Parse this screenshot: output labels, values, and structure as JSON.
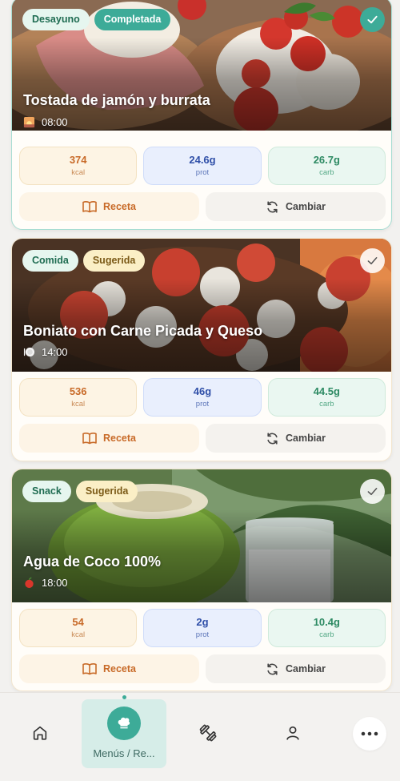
{
  "meals": [
    {
      "meal_type": "Desayuno",
      "status": "Completada",
      "title": "Tostada de jamón y burrata",
      "time": "08:00",
      "time_icon": "sunrise-icon",
      "completed": true,
      "kcal": "374",
      "kcal_unit": "kcal",
      "prot": "24.6g",
      "prot_unit": "prot",
      "carb": "26.7g",
      "carb_unit": "carb",
      "recipe_label": "Receta",
      "swap_label": "Cambiar"
    },
    {
      "meal_type": "Comida",
      "status": "Sugerida",
      "title": "Boniato con Carne Picada y Queso",
      "time": "14:00",
      "time_icon": "plate-icon",
      "completed": false,
      "kcal": "536",
      "kcal_unit": "kcal",
      "prot": "46g",
      "prot_unit": "prot",
      "carb": "44.5g",
      "carb_unit": "carb",
      "recipe_label": "Receta",
      "swap_label": "Cambiar"
    },
    {
      "meal_type": "Snack",
      "status": "Sugerida",
      "title": "Agua de Coco 100%",
      "time": "18:00",
      "time_icon": "apple-icon",
      "completed": false,
      "kcal": "54",
      "kcal_unit": "kcal",
      "prot": "2g",
      "prot_unit": "prot",
      "carb": "10.4g",
      "carb_unit": "carb",
      "recipe_label": "Receta",
      "swap_label": "Cambiar"
    }
  ],
  "nav": {
    "items": [
      "home-icon",
      "chef-hat-icon",
      "dumbbell-icon",
      "person-icon",
      "more-icon"
    ],
    "active_label": "Menús / Re..."
  },
  "colors": {
    "accent": "#3dab98",
    "orange": "#c86a28",
    "blue": "#2f4fa8",
    "green": "#2d8a63"
  }
}
